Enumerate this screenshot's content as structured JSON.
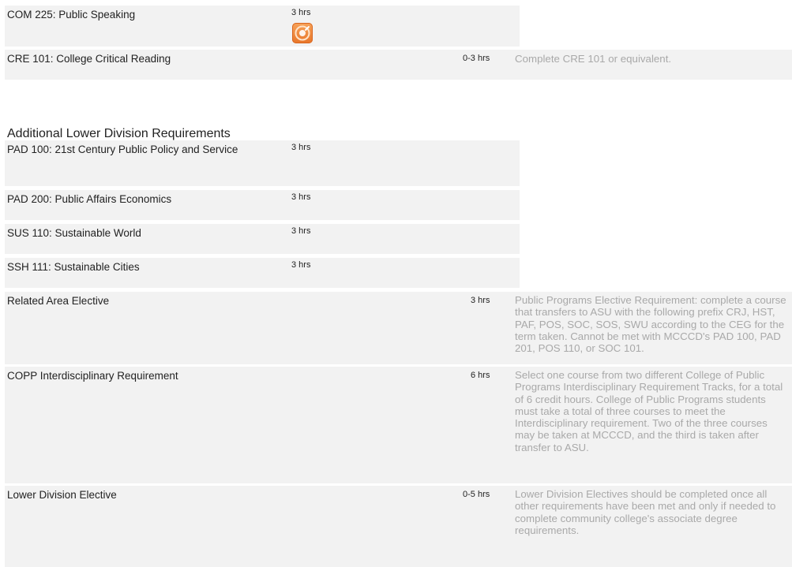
{
  "courses_top": [
    {
      "name": "COM 225: Public Speaking",
      "hours": "3 hrs",
      "icon": "course-badge-icon"
    },
    {
      "name": "CRE 101: College Critical Reading",
      "hours": "0-3 hrs",
      "note": "Complete CRE 101 or equivalent."
    }
  ],
  "section": {
    "title": "Additional Lower Division Requirements",
    "courses": [
      {
        "name": "PAD 100: 21st Century Public Policy and Service",
        "hours": "3 hrs"
      },
      {
        "name": "PAD 200: Public Affairs Economics",
        "hours": "3 hrs"
      },
      {
        "name": "SUS 110: Sustainable World",
        "hours": "3 hrs"
      },
      {
        "name": "SSH 111: Sustainable Cities",
        "hours": "3 hrs"
      }
    ],
    "electives": [
      {
        "name": "Related Area Elective",
        "hours": "3 hrs",
        "note": "Public Programs Elective Requirement: complete a course that transfers to ASU with the following prefix CRJ, HST, PAF, POS, SOC, SOS, SWU according to the CEG for the term taken. Cannot be met with MCCCD's PAD 100, PAD 201, POS 110, or SOC 101."
      },
      {
        "name": "COPP Interdisciplinary Requirement",
        "hours": "6 hrs",
        "note": "Select one course from two different College of Public Programs Interdisciplinary Requirement Tracks, for a total of 6 credit hours. College of Public Programs students must take a total of three courses to meet the Interdisciplinary requirement. Two of the three courses may be taken at MCCCD, and the third is taken after transfer to ASU."
      },
      {
        "name": "Lower Division Elective",
        "hours": "0-5 hrs",
        "note": "Lower Division Electives should be completed once all other requirements have been met and only if needed to complete community college's associate degree requirements."
      }
    ]
  },
  "colors": {
    "row_bg": "#f2f2f2",
    "note_text": "#a9a9a9",
    "icon_orange": "#e8762a"
  }
}
